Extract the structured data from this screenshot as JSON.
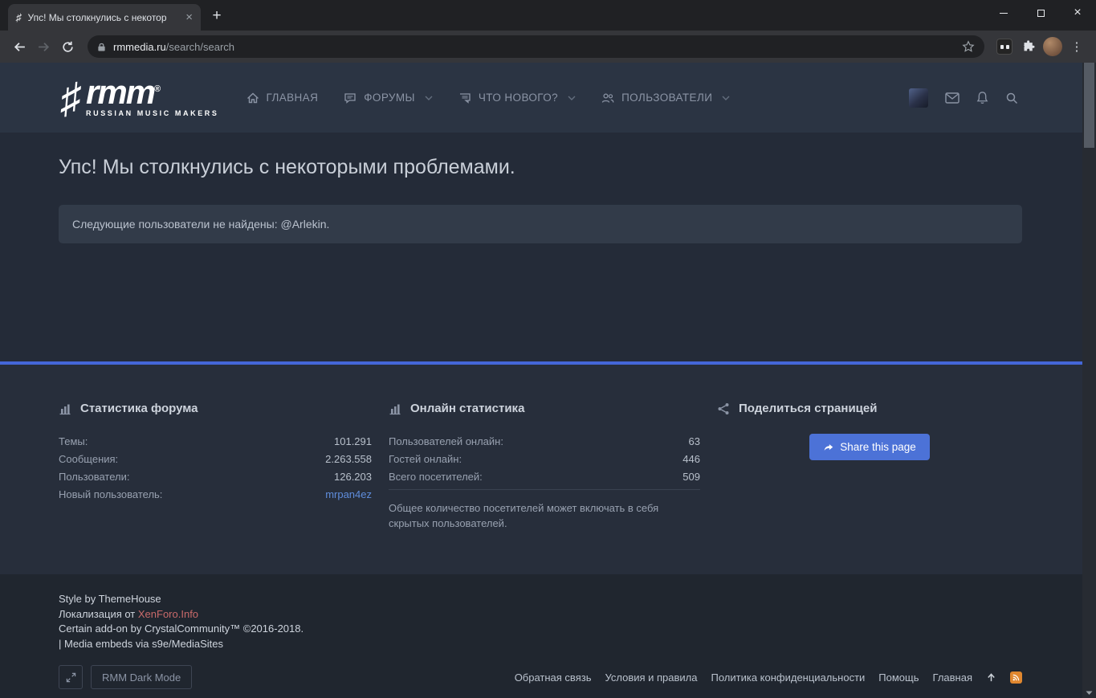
{
  "colors": {
    "accent_blue": "#4467d8",
    "link_blue": "#5f8ddc",
    "link_red": "#c96a6a",
    "rss_orange": "#e0872f",
    "share_button_blue": "#4c72d7"
  },
  "browser": {
    "tab_title": "Упс! Мы столкнулись с некотор",
    "url_domain": "rmmedia.ru",
    "url_path": "/search/search"
  },
  "site_header": {
    "logo_main": "rmm",
    "logo_reg": "®",
    "logo_sub": "RUSSIAN MUSIC MAKERS",
    "nav": [
      {
        "label": "ГЛАВНАЯ"
      },
      {
        "label": "ФОРУМЫ"
      },
      {
        "label": "ЧТО НОВОГО?"
      },
      {
        "label": "ПОЛЬЗОВАТЕЛИ"
      }
    ]
  },
  "main": {
    "page_title": "Упс! Мы столкнулись с некоторыми проблемами.",
    "error_message": "Следующие пользователи не найдены: @Arlekin."
  },
  "forum_stats": {
    "title": "Статистика форума",
    "rows": [
      {
        "label": "Темы:",
        "value": "101.291"
      },
      {
        "label": "Сообщения:",
        "value": "2.263.558"
      },
      {
        "label": "Пользователи:",
        "value": "126.203"
      },
      {
        "label": "Новый пользователь:",
        "value": "mrpan4ez"
      }
    ]
  },
  "online_stats": {
    "title": "Онлайн статистика",
    "rows": [
      {
        "label": "Пользователей онлайн:",
        "value": "63"
      },
      {
        "label": "Гостей онлайн:",
        "value": "446"
      },
      {
        "label": "Всего посетителей:",
        "value": "509"
      }
    ],
    "note": "Общее количество посетителей может включать в себя скрытых пользователей."
  },
  "share": {
    "title": "Поделиться страницей",
    "button_label": "Share this page"
  },
  "footer": {
    "credit_1": "Style by ThemeHouse",
    "credit_2_prefix": "Локализация от ",
    "credit_2_link": "XenForo.Info",
    "credit_3": "Certain add-on by CrystalCommunity™ ©2016-2018.",
    "credit_4": "| Media embeds via s9e/MediaSites",
    "dark_mode_button": "RMM Dark Mode",
    "links": [
      {
        "label": "Обратная связь"
      },
      {
        "label": "Условия и правила"
      },
      {
        "label": "Политика конфиденциальности"
      },
      {
        "label": "Помощь"
      },
      {
        "label": "Главная"
      }
    ]
  }
}
